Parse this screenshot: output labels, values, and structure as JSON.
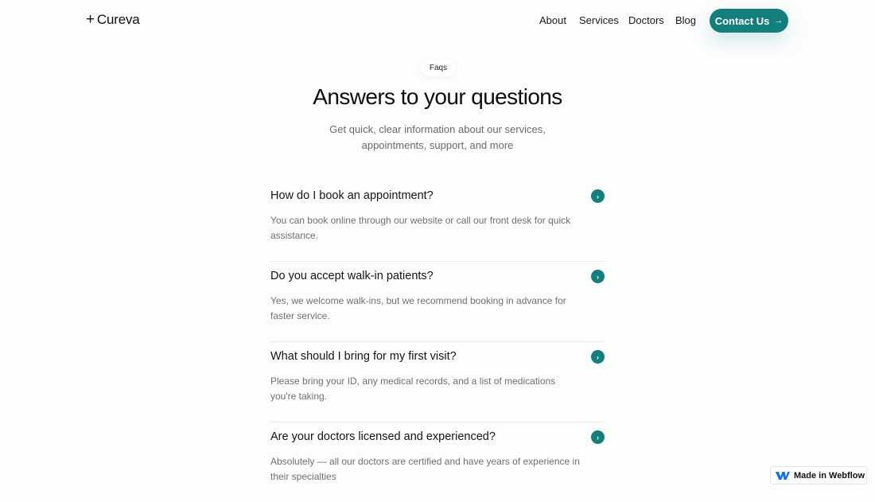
{
  "brand": {
    "name": "Cureva",
    "plus": "+"
  },
  "nav": {
    "links": [
      "About",
      "Services",
      "Doctors",
      "Blog"
    ],
    "cta": {
      "label": "Contact Us",
      "arrow": "→"
    }
  },
  "hero": {
    "badge": "Faqs",
    "title": "Answers to your questions",
    "subtitle": "Get quick, clear information about our services, appointments, support, and more"
  },
  "faqs": [
    {
      "question": "How do I book an appointment?",
      "answer": "You can book online through our website or call our front desk for quick assistance."
    },
    {
      "question": "Do you accept walk-in patients?",
      "answer": "Yes, we welcome walk-ins, but we recommend booking in advance for faster service."
    },
    {
      "question": "What should I bring for my first visit?",
      "answer": "Please bring your ID, any medical records, and a list of medications you're taking."
    },
    {
      "question": "Are your doctors licensed and experienced?",
      "answer": "Absolutely — all our doctors are certified and have years of experience in their specialties"
    }
  ],
  "faq_toggle_glyph": "›",
  "webflow_badge": {
    "label": "Made in Webflow"
  },
  "colors": {
    "accent": "#127f7c",
    "text": "#141414",
    "muted": "#707070"
  },
  "icons": {
    "faq_toggle": "chevron-right-icon",
    "cta": "arrow-right-icon",
    "webflow": "webflow-logo-icon"
  }
}
